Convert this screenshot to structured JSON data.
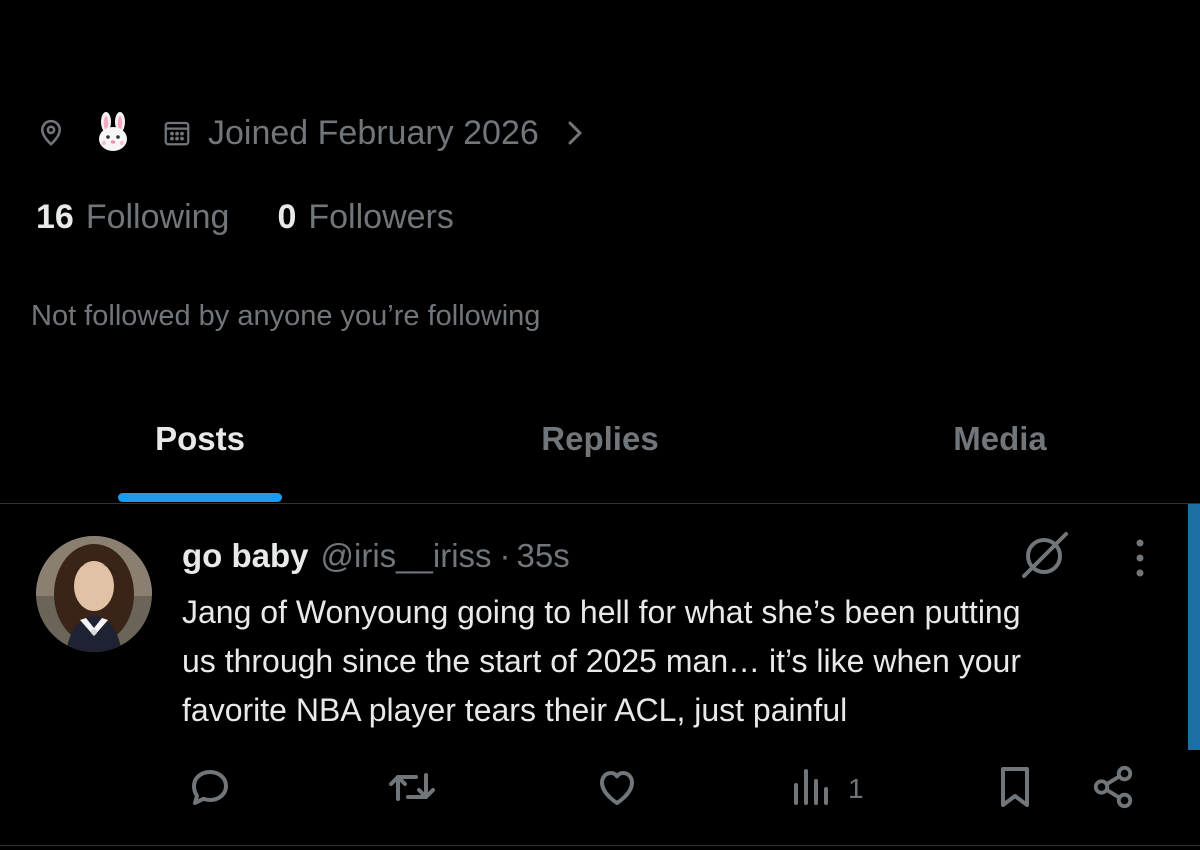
{
  "profile": {
    "location_emoji": "🐰",
    "joined": "Joined February 2026",
    "following_count": "16",
    "following_label": "Following",
    "followers_count": "0",
    "followers_label": "Followers",
    "mutuals_text": "Not followed by anyone you’re following"
  },
  "tabs": [
    {
      "label": "Posts",
      "active": true
    },
    {
      "label": "Replies",
      "active": false
    },
    {
      "label": "Media",
      "active": false
    }
  ],
  "post": {
    "display_name": "go baby",
    "handle": "@iris__iriss",
    "separator": "·",
    "time": "35s",
    "text_lines": [
      "Jang of Wonyoung going to hell for what she’s been putting",
      "us through since the start of 2025 man… it’s like when your",
      "favorite NBA player tears their ACL, just painful"
    ],
    "views_count": "1"
  },
  "icons": {
    "location": "location-pin-icon",
    "calendar": "calendar-icon",
    "chevron": "chevron-right-icon",
    "grok": "grok-icon",
    "more": "more-vertical-icon",
    "reply": "reply-icon",
    "repost": "repost-icon",
    "like": "heart-icon",
    "views": "views-chart-icon",
    "bookmark": "bookmark-icon",
    "share": "share-icon"
  },
  "colors": {
    "background": "#000000",
    "primary_text": "#e7e9ea",
    "secondary_text": "#71767b",
    "accent": "#1d9bf0",
    "divider": "#2f3336"
  }
}
